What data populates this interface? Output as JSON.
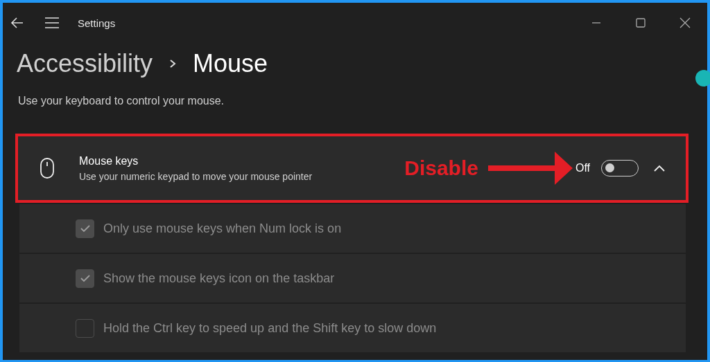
{
  "window": {
    "title": "Settings"
  },
  "breadcrumb": [
    "Accessibility",
    "Mouse"
  ],
  "description": "Use your keyboard to control your mouse.",
  "setting": {
    "title": "Mouse keys",
    "subtitle": "Use your numeric keypad to move your mouse pointer",
    "state_label": "Off",
    "on": false,
    "expanded": true
  },
  "annotation": {
    "label": "Disable"
  },
  "options": [
    {
      "label": "Only use mouse keys when Num lock is on",
      "checked": true,
      "disabled": true
    },
    {
      "label": "Show the mouse keys icon on the taskbar",
      "checked": true,
      "disabled": true
    },
    {
      "label": "Hold the Ctrl key to speed up and the Shift key to slow down",
      "checked": false,
      "disabled": true
    }
  ]
}
